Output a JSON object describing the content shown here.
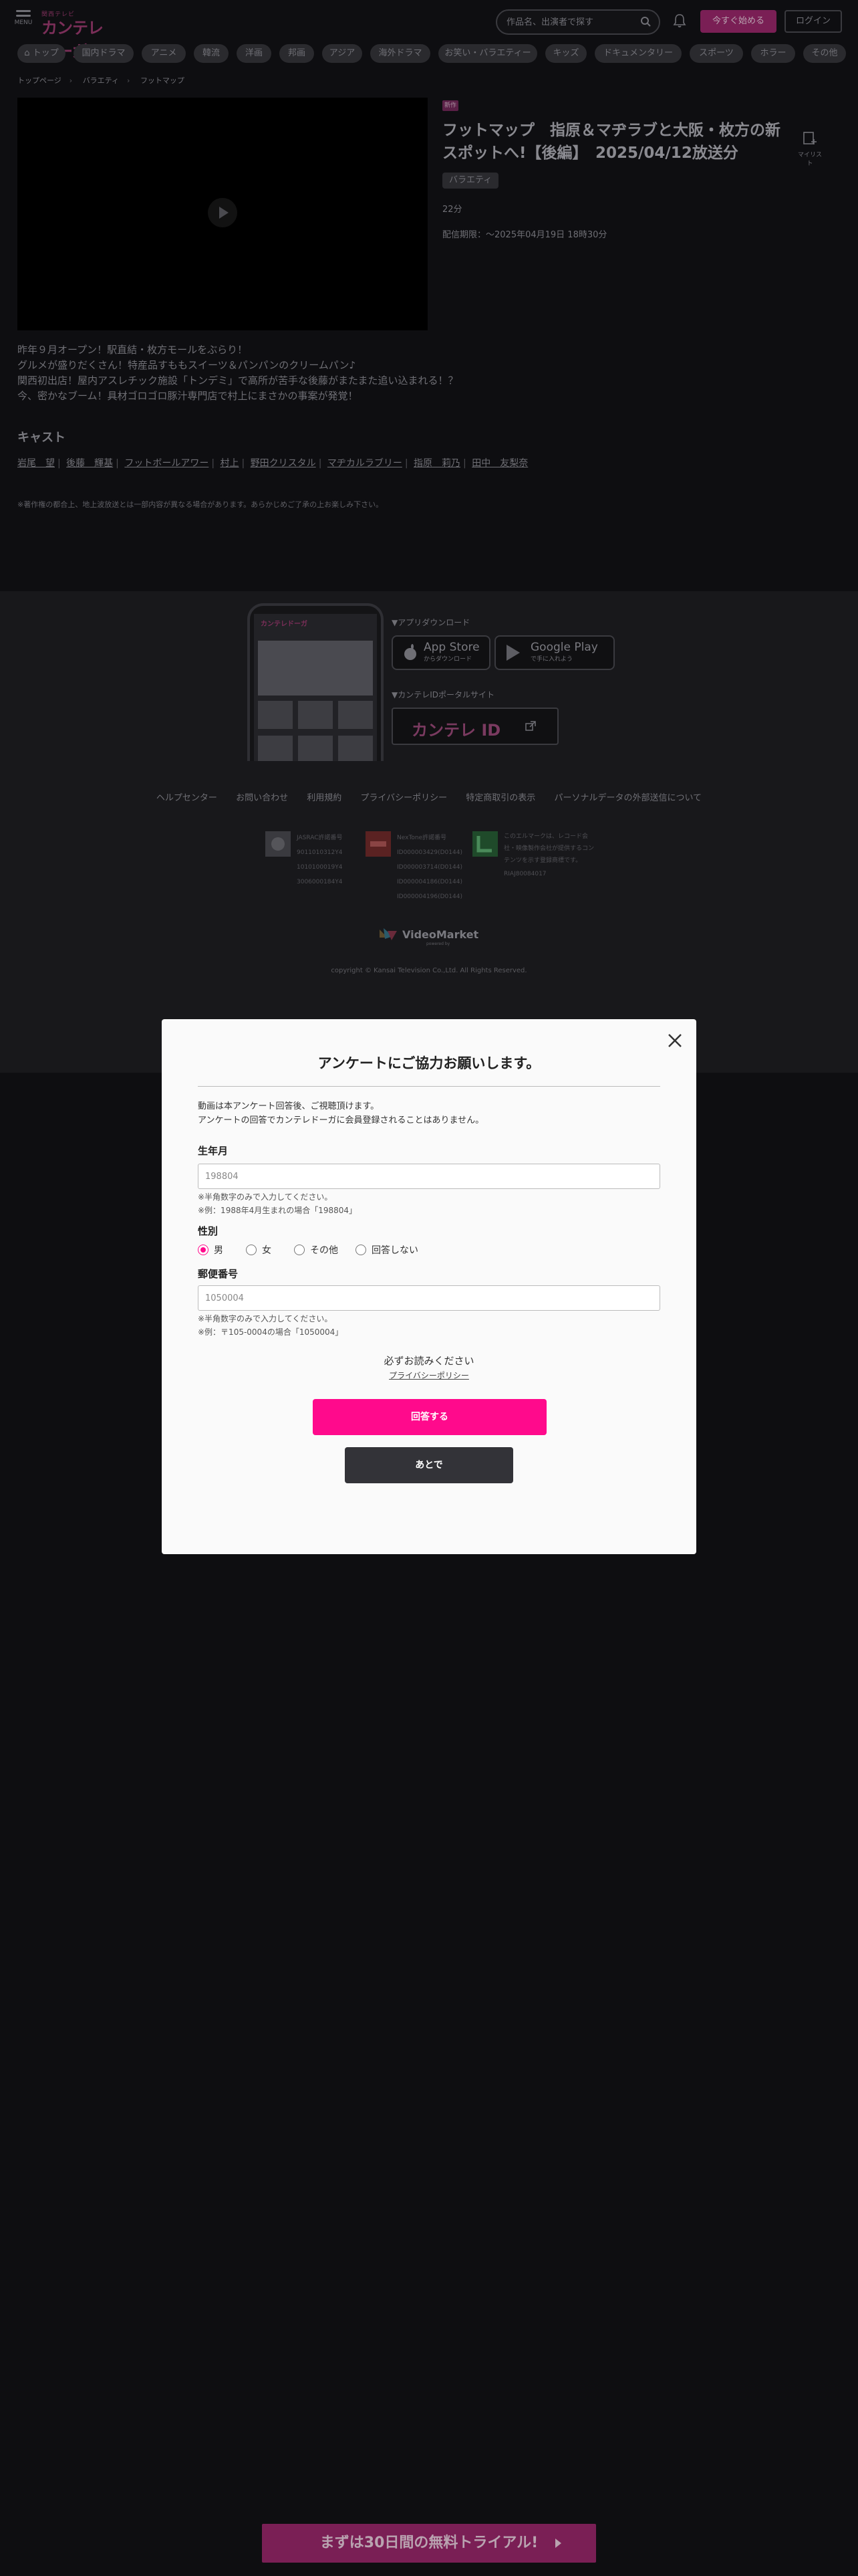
{
  "header": {
    "menu_label": "MENU",
    "logo_top": "関西テレビ",
    "logo_main": "カンテレドーガ",
    "search_placeholder": "作品名、出演者で探す",
    "start_button": "今すぐ始める",
    "login_button": "ログイン"
  },
  "nav": {
    "items": [
      "トップ",
      "国内ドラマ",
      "アニメ",
      "韓流",
      "洋画",
      "邦画",
      "アジア",
      "海外ドラマ",
      "お笑い・バラエティー",
      "キッズ",
      "ドキュメンタリー",
      "スポーツ",
      "ホラー",
      "その他"
    ]
  },
  "breadcrumb": [
    "トップページ",
    "バラエティ",
    "フットマップ"
  ],
  "program": {
    "new_badge": "新作",
    "title": "フットマップ　指原＆マヂラブと大阪・枚方の新スポットへ!【後編】　2025/04/12放送分",
    "mylist_label": "マイリスト",
    "genre": "バラエティ",
    "duration": "22分",
    "period": "配信期限：～2025年04月19日 18時30分",
    "description": [
      "昨年９月オープン！駅直結・枚方モールをぶらり！",
      "グルメが盛りだくさん！特産品すももスイーツ＆パンパンのクリームパン♪",
      "関西初出店！屋内アスレチック施設「トンデミ」で高所が苦手な後藤がまたまた追い込まれる！？",
      "今、密かなブーム！具材ゴロゴロ豚汁専門店で村上にまさかの事案が発覚！"
    ],
    "cast_heading": "キャスト",
    "cast": [
      "岩尾　望",
      "後藤　輝基",
      "フットボールアワー",
      "村上",
      "野田クリスタル",
      "マヂカルラブリー",
      "指原　莉乃",
      "田中　友梨奈"
    ],
    "notice": "※著作権の都合上、地上波放送とは一部内容が異なる場合があります。あらかじめご了承の上お楽しみ下さい。"
  },
  "footer": {
    "phone_logo": "カンテレドーガ",
    "app_heading": "▼アプリダウンロード",
    "appstore_small": "からダウンロード",
    "appstore_big": "App Store",
    "googleplay_small": "で手に入れよう",
    "googleplay_big": "Google Play",
    "portal_heading": "▼カンテレIDポータルサイト",
    "portal_text": "カンテレ ID",
    "links": [
      "ヘルプセンター",
      "お問い合わせ",
      "利用規約",
      "プライバシーポリシー",
      "特定商取引の表示",
      "パーソナルデータの外部送信について"
    ],
    "certs": [
      {
        "lines": [
          "JASRAC許諾番号",
          "9011010312Y4",
          "1010100019Y4",
          "3006000184Y4"
        ]
      },
      {
        "lines": [
          "NexTone許諾番号",
          "ID000003429(D0144)",
          "ID000003714(D0144)",
          "ID000004186(D0144)",
          "ID000004196(D0144)"
        ]
      },
      {
        "lines": [
          "このエルマークは、レコード会社・映像製作会社が提供するコンテンツを示す登録商標です。",
          "RIAJ80084017"
        ]
      }
    ],
    "vm_logo": "VideoMarket",
    "vm_sub": "powered by",
    "copyright": "copyright © Kansai Television Co.,Ltd. All Rights Reserved."
  },
  "modal": {
    "title": "アンケートにご協力お願いします。",
    "intro": [
      "動画は本アンケート回答後、ご視聴頂けます。",
      "アンケートの回答でカンテレドーガに会員登録されることはありません。"
    ],
    "birth_label": "生年月",
    "birth_placeholder": "198804",
    "birth_hints": [
      "※半角数字のみで入力してください。",
      "※例：1988年4月生まれの場合「198804」"
    ],
    "gender_label": "性別",
    "gender_options": [
      "男",
      "女",
      "その他",
      "回答しない"
    ],
    "gender_selected": "男",
    "zip_label": "郵便番号",
    "zip_placeholder": "1050004",
    "zip_hints": [
      "※半角数字のみで入力してください。",
      "※例：〒105-0004の場合「1050004」"
    ],
    "must_read": "必ずお読みください",
    "privacy_link": "プライバシーポリシー",
    "submit": "回答する",
    "later": "あとで"
  },
  "cta": {
    "trial": "まずは30日間の無料トライアル!"
  },
  "colors": {
    "accent": "#ff0a8c",
    "dim_accent": "#7a1f55",
    "background": "#0e0e11",
    "modal_bg": "#fafafa"
  }
}
